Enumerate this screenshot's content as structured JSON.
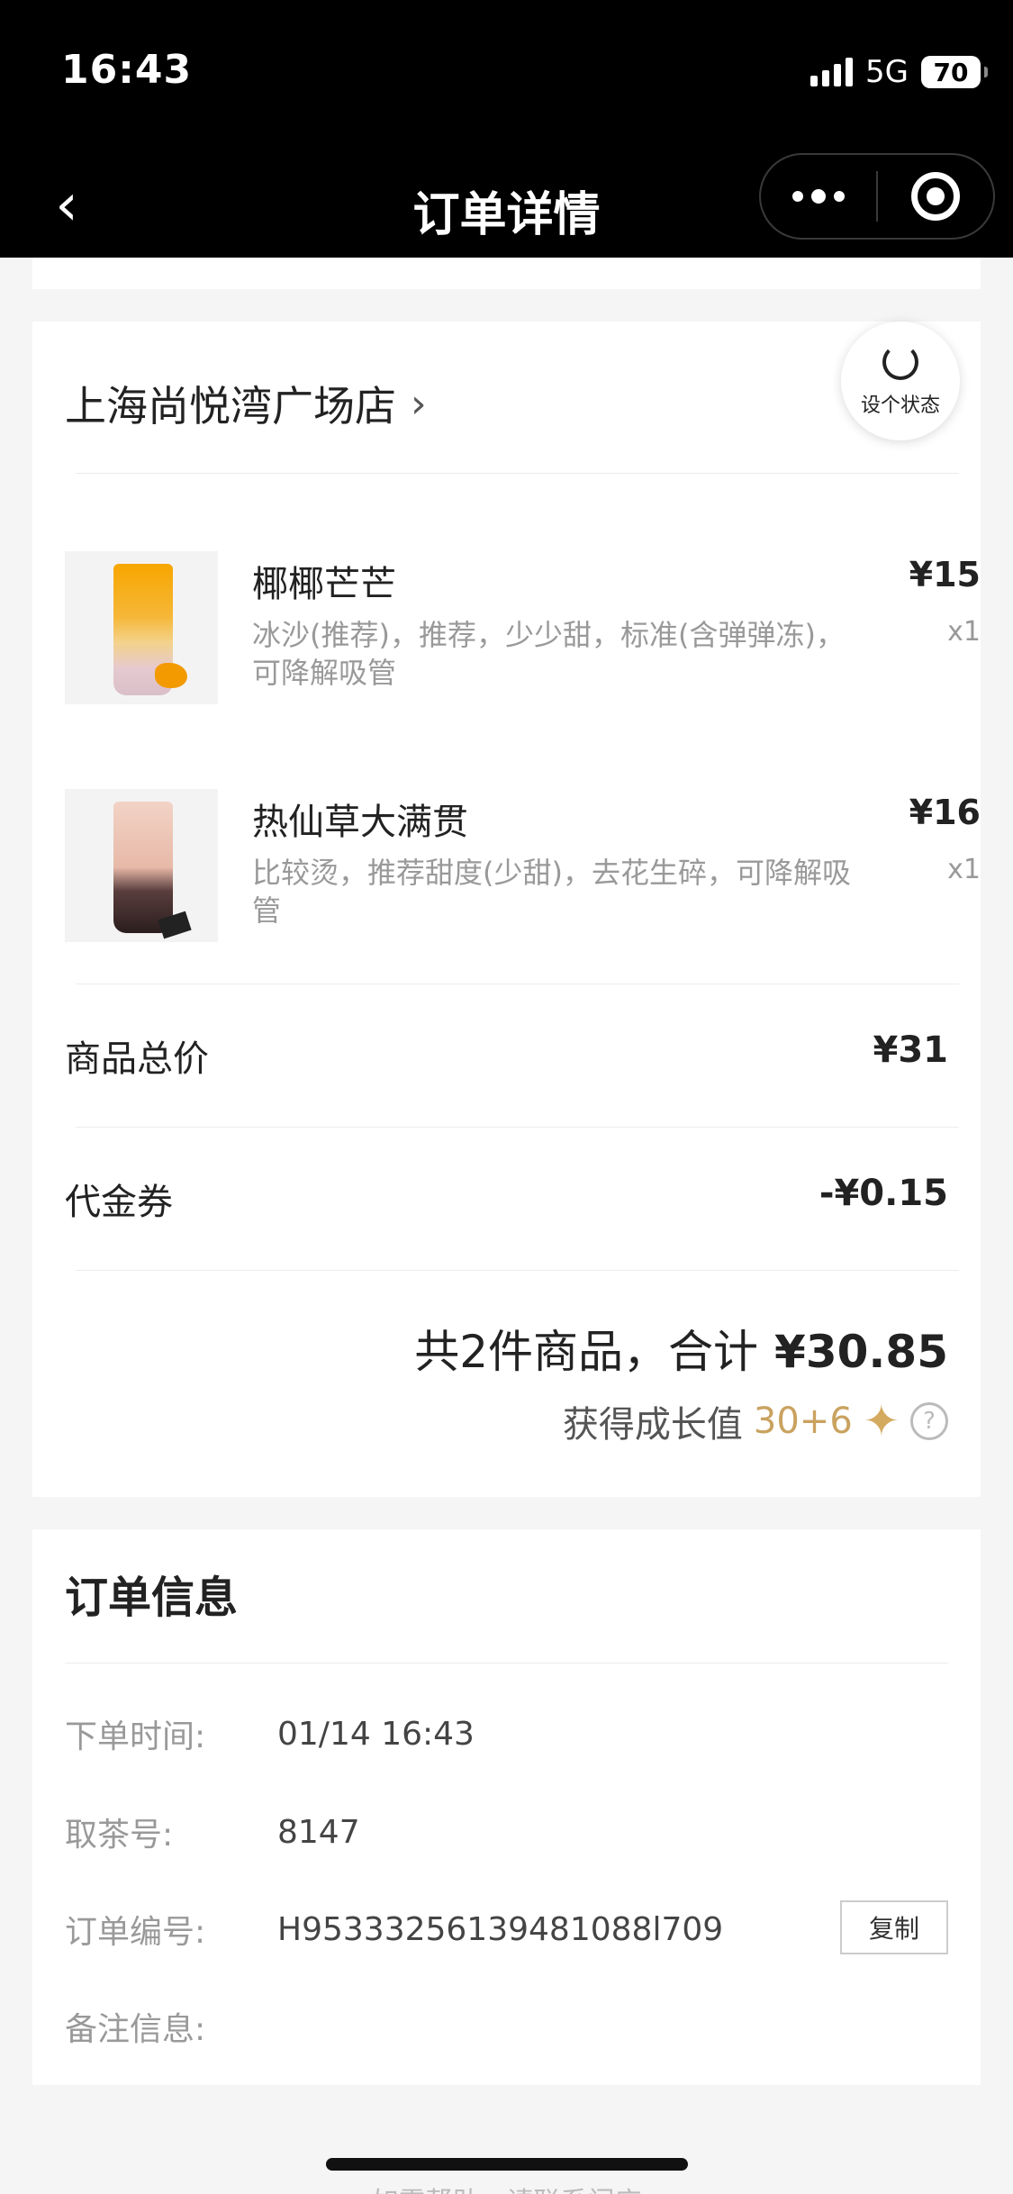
{
  "status_bar": {
    "time": "16:43",
    "network": "5G",
    "battery": "70"
  },
  "nav": {
    "title": "订单详情",
    "back_icon": "chevron-left-icon",
    "more_icon": "more-dots-icon",
    "target_icon": "target-circle-icon"
  },
  "store": {
    "name": "上海尚悦湾广场店",
    "status_button_label": "设个状态"
  },
  "items": [
    {
      "name": "椰椰芒芒",
      "spec_line1": "冰沙(推荐)，推荐，少少甜，标准(含弹弹冻)，",
      "spec_line2": "可降解吸管",
      "price": "¥15",
      "qty": "x1"
    },
    {
      "name": "热仙草大满贯",
      "spec_line1": "比较烫，推荐甜度(少甜)，去花生碎，可降解吸",
      "spec_line2": "管",
      "price": "¥16",
      "qty": "x1"
    }
  ],
  "summary": {
    "subtotal_label": "商品总价",
    "subtotal_value": "¥31",
    "coupon_label": "代金券",
    "coupon_value": "-¥0.15",
    "total_prefix": "共2件商品，合计",
    "total_amount": "¥30.85",
    "growth_label": "获得成长值",
    "growth_value": "30+6",
    "help_glyph": "?"
  },
  "order_info": {
    "title": "订单信息",
    "order_time_label": "下单时间:",
    "order_time_value": "01/14 16:43",
    "pickup_label": "取茶号:",
    "pickup_value": "8147",
    "order_no_label": "订单编号:",
    "order_no_value": "H95333256139481088l709",
    "copy_label": "复制",
    "remark_label": "备注信息:",
    "remark_value": ""
  },
  "footer": {
    "partial_text": "如需帮助，请联系门店"
  }
}
